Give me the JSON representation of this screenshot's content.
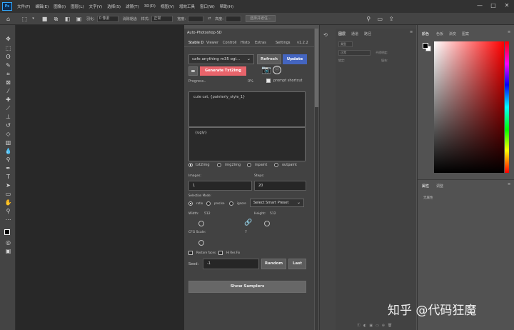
{
  "menubar": {
    "logo": "Ps",
    "items": [
      "文件(F)",
      "编辑(E)",
      "图像(I)",
      "图层(L)",
      "文字(Y)",
      "选择(S)",
      "滤镜(T)",
      "3D(D)",
      "视图(V)",
      "增效工具",
      "窗口(W)",
      "帮助(H)"
    ],
    "controls": [
      "—",
      "□",
      "✕"
    ]
  },
  "options_bar": {
    "feather_label": "羽化:",
    "feather_value": "0 像素",
    "antialias_label": "消除锯齿",
    "style_label": "样式:",
    "style_value": "正常",
    "width_label": "宽度:",
    "height_label": "高度:",
    "select_mask_button": "选择并遮住..."
  },
  "plugin": {
    "title": "Auto-Photoshop-SD",
    "tabs": [
      "Stable D",
      "Viewer",
      "Controll",
      "Histo",
      "Extras",
      "Settings"
    ],
    "version": "v1.2.2",
    "model": "cafe anything m35 ogi...",
    "refresh": "Refresh",
    "update": "Update",
    "generate": "Generate Txt2Img",
    "prompt_shortcut": "prompt shortcut",
    "progress_label": "Progress..",
    "progress_pct": "0%",
    "prompt": "cute cat, {painterly_style_1}",
    "negative": "{ugly}",
    "modes": [
      "txt2img",
      "img2img",
      "inpaint",
      "outpaint"
    ],
    "images_label": "Images:",
    "images_value": "1",
    "steps_label": "Steps:",
    "steps_value": "20",
    "selection_mode_label": "Selection Mode:",
    "selection_modes": [
      "ratio",
      "precise",
      "ignore"
    ],
    "smart_preset": "Select Smart Preset",
    "width_label": "Width:",
    "width_value": "512",
    "height_label": "Height:",
    "height_value": "512",
    "cfg_label": "CFG Scale:",
    "cfg_value": "7",
    "restore_faces": "Restore faces",
    "hires_fix": "Hi Res Fix",
    "seed_label": "Seed:",
    "seed_value": "-1",
    "random": "Random",
    "last": "Last",
    "show_samplers": "Show Samplers"
  },
  "mid_panel": {
    "tabs": [
      "图层",
      "通道",
      "路径"
    ],
    "kind_label": "类型",
    "mode_label": "正常",
    "opacity_label": "不透明度:",
    "lock_label": "锁定:",
    "fill_label": "填充:"
  },
  "right_panel": {
    "top_tabs": [
      "颜色",
      "色板",
      "渐变",
      "图案"
    ],
    "bottom_tabs": [
      "属性",
      "调整"
    ],
    "no_properties": "无属性"
  },
  "colors": {
    "fg": "#000000",
    "bg": "#ffffff",
    "blue_button": "#4465c0",
    "red_button": "#e8646b"
  },
  "watermark": "知乎 @代码狂魔"
}
